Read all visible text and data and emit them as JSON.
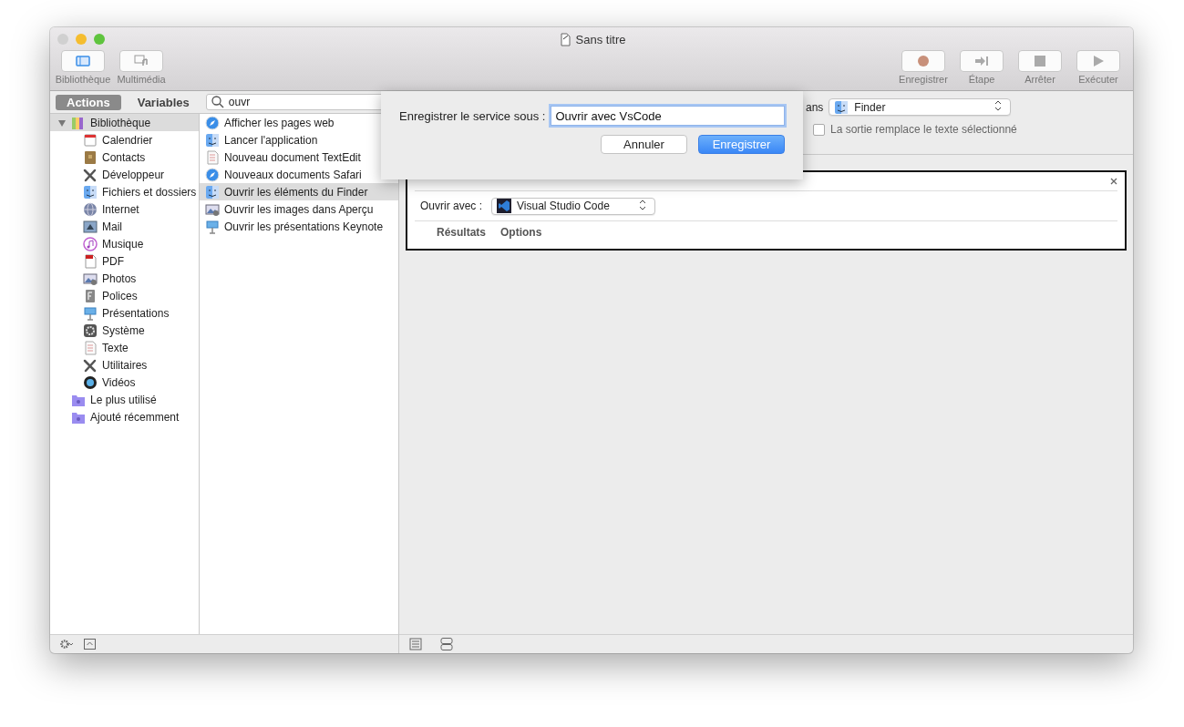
{
  "window": {
    "title": "Sans titre"
  },
  "toolbar": {
    "left": [
      {
        "label": "Bibliothèque",
        "selected": true
      },
      {
        "label": "Multimédia",
        "selected": false
      }
    ],
    "right": [
      {
        "label": "Enregistrer"
      },
      {
        "label": "Étape"
      },
      {
        "label": "Arrêter"
      },
      {
        "label": "Exécuter"
      }
    ]
  },
  "segments": [
    {
      "label": "Actions",
      "selected": true
    },
    {
      "label": "Variables",
      "selected": false
    }
  ],
  "search": {
    "value": "ouvr"
  },
  "library": [
    {
      "label": "Bibliothèque",
      "selected": true,
      "expanded": true,
      "children": [
        {
          "label": "Calendrier"
        },
        {
          "label": "Contacts"
        },
        {
          "label": "Développeur"
        },
        {
          "label": "Fichiers et dossiers"
        },
        {
          "label": "Internet"
        },
        {
          "label": "Mail"
        },
        {
          "label": "Musique"
        },
        {
          "label": "PDF"
        },
        {
          "label": "Photos"
        },
        {
          "label": "Polices"
        },
        {
          "label": "Présentations"
        },
        {
          "label": "Système"
        },
        {
          "label": "Texte"
        },
        {
          "label": "Utilitaires"
        },
        {
          "label": "Vidéos"
        }
      ]
    },
    {
      "label": "Le plus utilisé",
      "selected": false
    },
    {
      "label": "Ajouté récemment",
      "selected": false
    }
  ],
  "actions": [
    {
      "label": "Afficher les pages web",
      "selected": false
    },
    {
      "label": "Lancer l'application",
      "selected": false
    },
    {
      "label": "Nouveau document TextEdit",
      "selected": false
    },
    {
      "label": "Nouveaux documents Safari",
      "selected": false
    },
    {
      "label": "Ouvrir les éléments du Finder",
      "selected": true
    },
    {
      "label": "Ouvrir les images dans Aperçu",
      "selected": false
    },
    {
      "label": "Ouvrir les présentations Keynote",
      "selected": false
    }
  ],
  "service": {
    "label_fragment": "ans",
    "app": "Finder",
    "replace_label": "La sortie remplace le texte sélectionné",
    "replace_checked": false
  },
  "card": {
    "open_with_label": "Ouvrir avec :",
    "open_with_value": "Visual Studio Code",
    "tabs": [
      {
        "label": "Résultats"
      },
      {
        "label": "Options"
      }
    ]
  },
  "sheet": {
    "label": "Enregistrer le service sous :",
    "value": "Ouvrir avec VsCode",
    "buttons": [
      {
        "label": "Annuler",
        "kind": "cancel"
      },
      {
        "label": "Enregistrer",
        "kind": "default"
      }
    ]
  }
}
